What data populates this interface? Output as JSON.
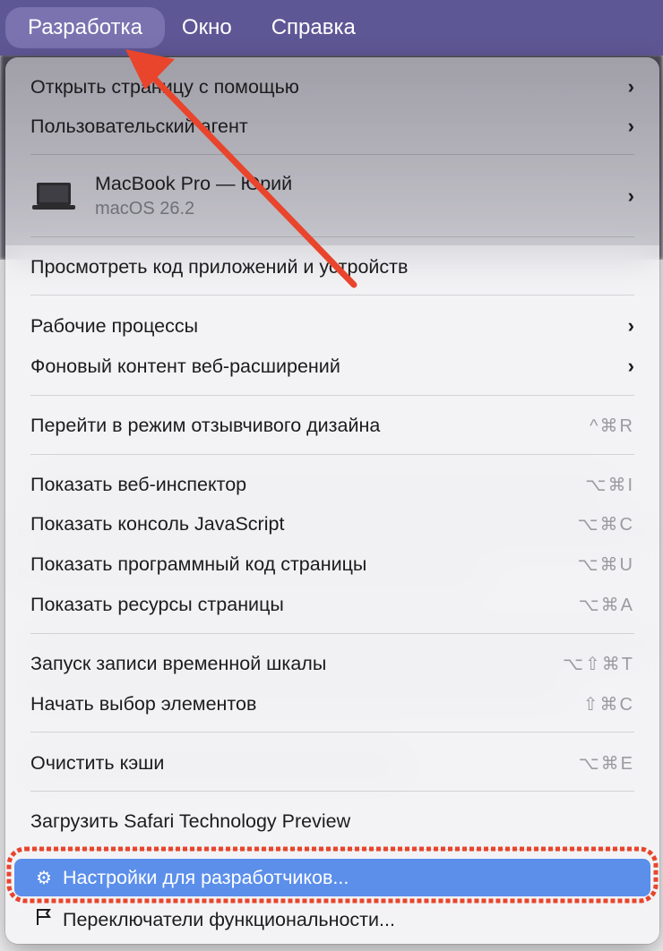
{
  "menubar": {
    "items": [
      {
        "label": "Разработка",
        "active": true
      },
      {
        "label": "Окно",
        "active": false
      },
      {
        "label": "Справка",
        "active": false
      }
    ]
  },
  "menu": {
    "open_with": "Открыть страницу с помощью",
    "user_agent": "Пользовательский агент",
    "device": {
      "name": "MacBook Pro — Юрий",
      "os": "macOS 26.2",
      "icon": "laptop-icon"
    },
    "view_code": "Просмотреть код приложений и устройств",
    "workflows": "Рабочие процессы",
    "background_content": "Фоновый контент веб-расширений",
    "responsive": {
      "label": "Перейти в режим отзывчивого дизайна",
      "shortcut": "^⌘R"
    },
    "show_inspector": {
      "label": "Показать веб-инспектор",
      "shortcut": "⌥⌘I"
    },
    "show_console": {
      "label": "Показать консоль JavaScript",
      "shortcut": "⌥⌘C"
    },
    "show_source": {
      "label": "Показать программный код страницы",
      "shortcut": "⌥⌘U"
    },
    "show_resources": {
      "label": "Показать ресурсы страницы",
      "shortcut": "⌥⌘A"
    },
    "timeline": {
      "label": "Запуск записи временной шкалы",
      "shortcut": "⌥⇧⌘T"
    },
    "select_element": {
      "label": "Начать выбор элементов",
      "shortcut": "⇧⌘C"
    },
    "clear_caches": {
      "label": "Очистить кэши",
      "shortcut": "⌥⌘E"
    },
    "download_stp": "Загрузить Safari Technology Preview",
    "developer_settings": {
      "label": "Настройки для разработчиков...",
      "icon": "gear-icon"
    },
    "feature_flags": {
      "label": "Переключатели функциональности...",
      "icon": "flag-icon"
    }
  },
  "colors": {
    "menubar": "#5e5795",
    "highlight": "#5b8fea",
    "annotation": "#e8452c"
  }
}
